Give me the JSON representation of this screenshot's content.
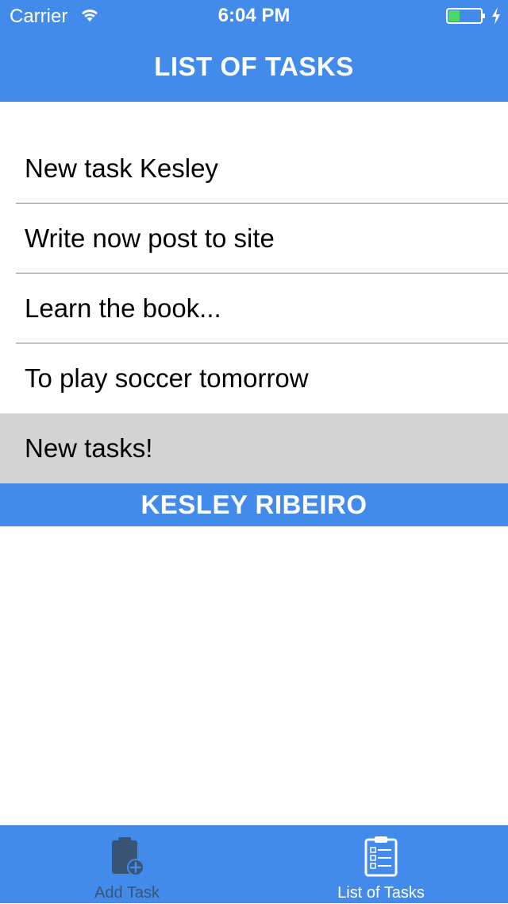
{
  "status_bar": {
    "carrier": "Carrier",
    "time": "6:04 PM",
    "battery_level": 0.35
  },
  "header": {
    "title": "LIST OF TASKS"
  },
  "tasks": [
    {
      "label": "New task Kesley",
      "selected": false
    },
    {
      "label": "Write now post to site",
      "selected": false
    },
    {
      "label": "Learn the book...",
      "selected": false
    },
    {
      "label": "To play soccer tomorrow",
      "selected": false
    },
    {
      "label": "New tasks!",
      "selected": true
    }
  ],
  "footer": {
    "name": "KESLEY RIBEIRO"
  },
  "tab_bar": {
    "tabs": [
      {
        "label": "Add Task",
        "icon": "clipboard-add-icon",
        "active": false
      },
      {
        "label": "List of Tasks",
        "icon": "clipboard-list-icon",
        "active": true
      }
    ]
  },
  "colors": {
    "accent": "#428bea",
    "selected_row": "#d3d3d3",
    "inactive_tab": "#3a5573",
    "battery_fill": "#4cd964"
  }
}
